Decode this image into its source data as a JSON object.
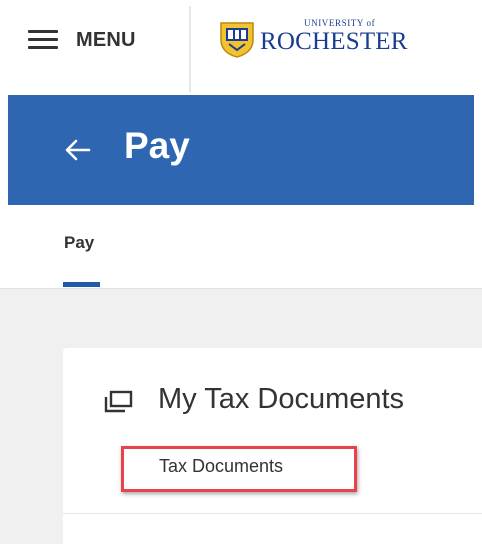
{
  "header": {
    "menu_label": "MENU",
    "logo": {
      "top_text": "UNIVERSITY of",
      "main_text": "ROCHESTER"
    }
  },
  "banner": {
    "title": "Pay",
    "color": "#2f66b2"
  },
  "tabs": [
    {
      "label": "Pay",
      "active": true
    }
  ],
  "card": {
    "title": "My Tax Documents",
    "link": "Tax Documents"
  },
  "colors": {
    "accent": "#1f5aa8",
    "highlight": "#e8434a",
    "background": "#f0f0f0"
  },
  "icons": {
    "menu": "hamburger-icon",
    "back": "back-arrow-icon",
    "card": "documents-icon"
  }
}
